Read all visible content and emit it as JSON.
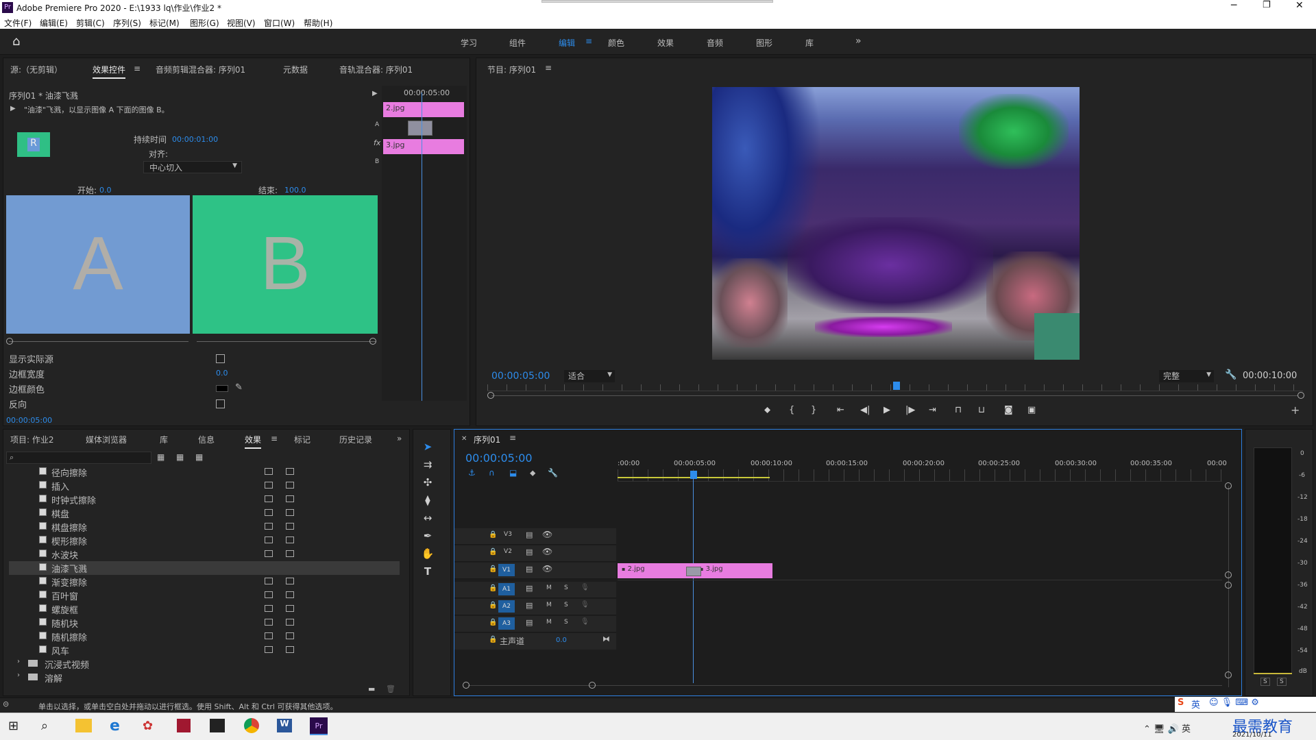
{
  "app": {
    "title": "Adobe Premiere Pro 2020 - E:\\1933 lq\\作业\\作业2 *",
    "logo": "Pr"
  },
  "menu": [
    "文件(F)",
    "编辑(E)",
    "剪辑(C)",
    "序列(S)",
    "标记(M)",
    "图形(G)",
    "视图(V)",
    "窗口(W)",
    "帮助(H)"
  ],
  "workspaces": [
    "学习",
    "组件",
    "编辑",
    "颜色",
    "效果",
    "音频",
    "图形",
    "库"
  ],
  "workspace_active": "编辑",
  "effect_controls": {
    "tabs": [
      "源:（无剪辑）",
      "效果控件",
      "音频剪辑混合器: 序列01",
      "元数据",
      "音轨混合器: 序列01"
    ],
    "active_tab": "效果控件",
    "clip": "序列01 * 油漆飞溅",
    "description": "\"油漆\"飞溅，以显示图像 A 下面的图像 B。",
    "duration_label": "持续时间",
    "duration": "00:00:01:00",
    "align_label": "对齐:",
    "align_value": "中心切入",
    "start_label": "开始:",
    "start_value": "0.0",
    "end_label": "结束:",
    "end_value": "100.0",
    "a_letter": "A",
    "b_letter": "B",
    "mini_time": "00:00:05:00",
    "clip_a": "2.jpg",
    "clip_b": "3.jpg",
    "props": [
      {
        "label": "显示实际源"
      },
      {
        "label": "边框宽度",
        "value": "0.0"
      },
      {
        "label": "边框颜色"
      },
      {
        "label": "反向"
      }
    ],
    "footer_time": "00:00:05:00"
  },
  "program": {
    "title": "节目: 序列01",
    "timecode": "00:00:05:00",
    "fit": "适合",
    "quality": "完整",
    "duration": "00:00:10:00"
  },
  "project": {
    "tabs": [
      "项目: 作业2",
      "媒体浏览器",
      "库",
      "信息",
      "效果",
      "标记",
      "历史记录"
    ],
    "active_tab": "效果",
    "items": [
      "径向擦除",
      "插入",
      "时钟式擦除",
      "棋盘",
      "棋盘擦除",
      "楔形擦除",
      "水波块",
      "油漆飞溅",
      "渐变擦除",
      "百叶窗",
      "螺旋框",
      "随机块",
      "随机擦除",
      "风车"
    ],
    "selected": "油漆飞溅",
    "folders": [
      "沉浸式视频",
      "溶解"
    ]
  },
  "timeline": {
    "title": "序列01",
    "timecode": "00:00:05:00",
    "ruler": [
      ":00:00",
      "00:00:05:00",
      "00:00:10:00",
      "00:00:15:00",
      "00:00:20:00",
      "00:00:25:00",
      "00:00:30:00",
      "00:00:35:00",
      "00:00"
    ],
    "video_tracks": [
      "V3",
      "V2",
      "V1"
    ],
    "audio_tracks": [
      "A1",
      "A2",
      "A3"
    ],
    "master_label": "主声道",
    "master_value": "0.0",
    "clips": [
      {
        "name": "2.jpg"
      },
      {
        "name": "3.jpg"
      }
    ],
    "m": "M",
    "s": "S"
  },
  "meter": {
    "labels": [
      "0",
      "-6",
      "-12",
      "-18",
      "-24",
      "-30",
      "-36",
      "-42",
      "-48",
      "-54",
      "dB"
    ],
    "solo": [
      "S",
      "S"
    ]
  },
  "status": "单击以选择，或单击空白处并拖动以进行框选。使用 Shift、Alt 和 Ctrl 可获得其他选项。",
  "taskbar": {
    "date": "2021/10/11",
    "watermark": "最需教育",
    "ime": "英"
  }
}
